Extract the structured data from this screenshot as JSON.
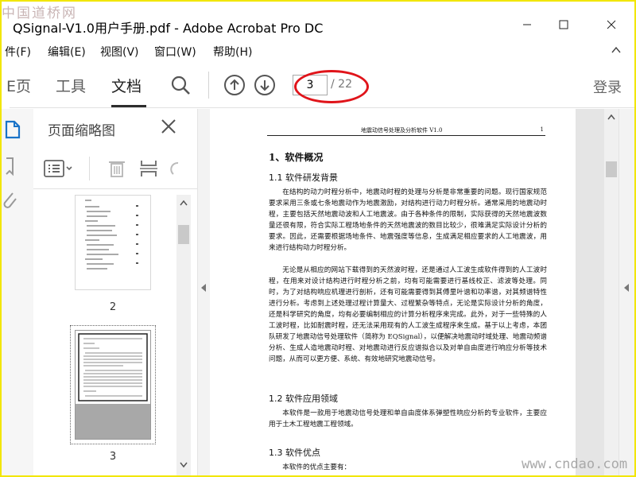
{
  "watermark_top": "中国道桥网",
  "window": {
    "title": "QSignal-V1.0用户手册.pdf - Adobe Acrobat Pro DC"
  },
  "menu": [
    "件(F)",
    "编辑(E)",
    "视图(V)",
    "窗口(W)",
    "帮助(H)"
  ],
  "toolbar": {
    "tabs": [
      "E页",
      "工具",
      "文档"
    ],
    "active_tab": "文档",
    "page_current": "3",
    "page_total": "/ 22",
    "login_label": "登录"
  },
  "thumbnail_panel": {
    "title": "页面缩略图",
    "thumbnails": [
      {
        "number": "2"
      },
      {
        "number": "3",
        "selected": true
      }
    ]
  },
  "document": {
    "header_title": "地震动信号处理及分析软件 V1.0",
    "header_page": "1",
    "section1_title": "1、软件概况",
    "sub11_title": "1.1 软件研发背景",
    "para1": "在结构的动力时程分析中，地震动时程的处理与分析是非常重要的问题。现行国家规范要求采用三条或七条地震动作为地震激励，对结构进行动力时程分析。通常采用的地震动时程，主要包括天然地震动波和人工地震波。由于各种条件的限制，实际获得的天然地震波数量还很有限，符合实际工程场地条件的天然地震波的数目比较少，很难满足实际设计分析的要求。因此，还需要根据场地条件、地震强度等信息，生成满足相应要求的人工地震波，用来进行结构动力时程分析。",
    "para2": "无论是从相应的网站下载得到的天然波时程，还是通过人工波生成软件得到的人工波时程，在用来对设计结构进行时程分析之前，均有可能需要进行基线校正、滤波等处理。同时，为了对结构响应机理进行剖析，还有可能需要得到其傅里叶谱和功率谱，对其频谱特性进行分析。考虑到上述处理过程计算量大、过程繁杂等特点，无论是实际设计分析的角度，还是科学研究的角度，均有必要编制相应的计算分析程序来完成。此外，对于一些特殊的人工波时程，比如耐震时程，还无法采用现有的人工波生成程序来生成。基于以上考虑，本团队研发了地震动信号处理软件（简称为 EQSignal），以便解决地震动时域处理、地震动频谱分析、生成人造地震动时程、对地震动进行反应谱拟合以及对单自由度进行响应分析等技术问题，从而可以更方便、系统、有效地研究地震动信号。",
    "sub12_title": "1.2 软件应用领域",
    "para3": "本软件是一款用于地震动信号处理和单自由度体系弹塑性响应分析的专业软件，主要应用于土木工程地震工程领域。",
    "sub13_title": "1.3 软件优点",
    "para4": "本软件的优点主要有："
  },
  "watermark_bottom": "www.cndao.com",
  "colors": {
    "highlight_oval": "#e0141a",
    "border": "#f2e600"
  }
}
